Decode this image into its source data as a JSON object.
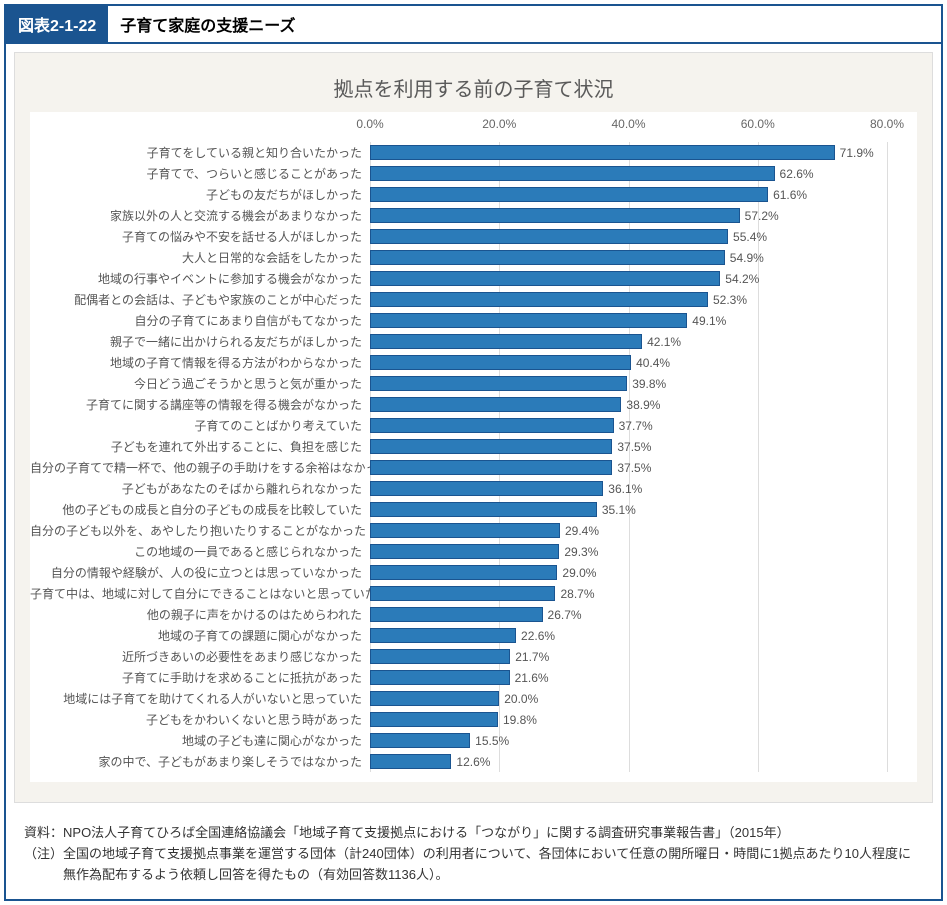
{
  "header": {
    "fig_number": "図表2-1-22",
    "fig_title": "子育て家庭の支援ニーズ"
  },
  "chart_data": {
    "type": "bar",
    "orientation": "horizontal",
    "title": "拠点を利用する前の子育て状況",
    "xlabel": "",
    "ylabel": "",
    "xlim": [
      0,
      80
    ],
    "x_ticks": [
      0.0,
      20.0,
      40.0,
      60.0,
      80.0
    ],
    "x_tick_labels": [
      "0.0%",
      "20.0%",
      "40.0%",
      "60.0%",
      "80.0%"
    ],
    "categories": [
      "子育てをしている親と知り合いたかった",
      "子育てで、つらいと感じることがあった",
      "子どもの友だちがほしかった",
      "家族以外の人と交流する機会があまりなかった",
      "子育ての悩みや不安を話せる人がほしかった",
      "大人と日常的な会話をしたかった",
      "地域の行事やイベントに参加する機会がなかった",
      "配偶者との会話は、子どもや家族のことが中心だった",
      "自分の子育てにあまり自信がもてなかった",
      "親子で一緒に出かけられる友だちがほしかった",
      "地域の子育て情報を得る方法がわからなかった",
      "今日どう過ごそうかと思うと気が重かった",
      "子育てに関する講座等の情報を得る機会がなかった",
      "子育てのことばかり考えていた",
      "子どもを連れて外出することに、負担を感じた",
      "自分の子育てで精一杯で、他の親子の手助けをする余裕はなかった",
      "子どもがあなたのそばから離れられなかった",
      "他の子どもの成長と自分の子どもの成長を比較していた",
      "自分の子ども以外を、あやしたり抱いたりすることがなかった",
      "この地域の一員であると感じられなかった",
      "自分の情報や経験が、人の役に立つとは思っていなかった",
      "子育て中は、地域に対して自分にできることはないと思っていた",
      "他の親子に声をかけるのはためらわれた",
      "地域の子育ての課題に関心がなかった",
      "近所づきあいの必要性をあまり感じなかった",
      "子育てに手助けを求めることに抵抗があった",
      "地域には子育てを助けてくれる人がいないと思っていた",
      "子どもをかわいくないと思う時があった",
      "地域の子ども達に関心がなかった",
      "家の中で、子どもがあまり楽しそうではなかった"
    ],
    "values": [
      71.9,
      62.6,
      61.6,
      57.2,
      55.4,
      54.9,
      54.2,
      52.3,
      49.1,
      42.1,
      40.4,
      39.8,
      38.9,
      37.7,
      37.5,
      37.5,
      36.1,
      35.1,
      29.4,
      29.3,
      29.0,
      28.7,
      26.7,
      22.6,
      21.7,
      21.6,
      20.0,
      19.8,
      15.5,
      12.6
    ],
    "value_labels": [
      "71.9%",
      "62.6%",
      "61.6%",
      "57.2%",
      "55.4%",
      "54.9%",
      "54.2%",
      "52.3%",
      "49.1%",
      "42.1%",
      "40.4%",
      "39.8%",
      "38.9%",
      "37.7%",
      "37.5%",
      "37.5%",
      "36.1%",
      "35.1%",
      "29.4%",
      "29.3%",
      "29.0%",
      "28.7%",
      "26.7%",
      "22.6%",
      "21.7%",
      "21.6%",
      "20.0%",
      "19.8%",
      "15.5%",
      "12.6%"
    ]
  },
  "footer": {
    "source_label": "資料：",
    "source_text": "NPO法人子育てひろば全国連絡協議会「地域子育て支援拠点における「つながり」に関する調査研究事業報告書」（2015年）",
    "note_label": "（注）",
    "note_text": "全国の地域子育て支援拠点事業を運営する団体（計240団体）の利用者について、各団体において任意の開所曜日・時間に1拠点あたり10人程度に無作為配布するよう依頼し回答を得たもの（有効回答数1136人）。"
  }
}
